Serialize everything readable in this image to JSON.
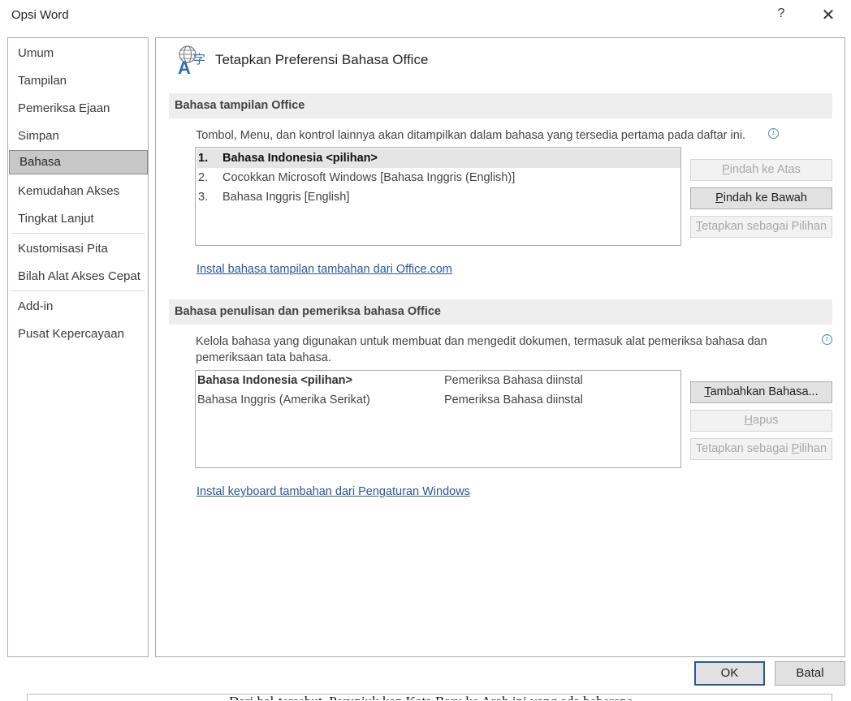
{
  "window": {
    "title": "Opsi Word",
    "help": "?",
    "close": "✕"
  },
  "sidebar": {
    "items": [
      {
        "label": "Umum"
      },
      {
        "label": "Tampilan"
      },
      {
        "label": "Pemeriksa Ejaan"
      },
      {
        "label": "Simpan"
      },
      {
        "label": "Bahasa",
        "selected": true
      },
      {
        "label": "Kemudahan Akses"
      },
      {
        "label": "Tingkat Lanjut"
      },
      {
        "label": "Kustomisasi Pita"
      },
      {
        "label": "Bilah Alat Akses Cepat"
      },
      {
        "label": "Add-in"
      },
      {
        "label": "Pusat Kepercayaan"
      }
    ]
  },
  "header": {
    "title": "Tetapkan Preferensi Bahasa Office",
    "icon": "language-icon"
  },
  "display_section": {
    "title": "Bahasa tampilan Office",
    "description": "Tombol, Menu, dan kontrol lainnya akan ditampilkan dalam bahasa yang tersedia pertama pada daftar ini.",
    "items": [
      {
        "num": "1.",
        "label": "Bahasa Indonesia <pilihan>"
      },
      {
        "num": "2.",
        "label": "Cocokkan Microsoft Windows [Bahasa Inggris (English)]"
      },
      {
        "num": "3.",
        "label": "Bahasa Inggris [English]"
      }
    ],
    "buttons": {
      "move_up": {
        "pre": "",
        "key": "P",
        "post": "indah ke Atas"
      },
      "move_down": {
        "pre": "",
        "key": "P",
        "post": "indah ke Bawah"
      },
      "set_preferred": {
        "pre": "",
        "key": "T",
        "post": "etapkan sebagai Pilihan"
      }
    },
    "link": "Instal bahasa tampilan tambahan dari Office.com"
  },
  "authoring_section": {
    "title": "Bahasa penulisan dan pemeriksa bahasa Office",
    "description_line1": "Kelola bahasa yang digunakan untuk membuat dan mengedit dokumen, termasuk alat pemeriksa bahasa dan",
    "description_line2": "pemeriksaan tata bahasa.",
    "rows": [
      {
        "language": "Bahasa Indonesia <pilihan>",
        "status": "Pemeriksa Bahasa diinstal"
      },
      {
        "language": "Bahasa Inggris (Amerika Serikat)",
        "status": "Pemeriksa Bahasa diinstal"
      }
    ],
    "buttons": {
      "add": {
        "pre": "",
        "key": "T",
        "post": "ambahkan Bahasa..."
      },
      "remove": {
        "pre": "",
        "key": "H",
        "post": "apus"
      },
      "set_preferred": {
        "pre": "Tetapkan sebagai ",
        "key": "P",
        "post": "ilihan"
      }
    },
    "link": "Instal keyboard tambahan dari Pengaturan Windows"
  },
  "footer": {
    "ok": "OK",
    "cancel": "Batal"
  },
  "bottom_text": "Dari hal-tersebut, Perunjuk kan Kata Baru ke Arah ini yang ada beberapa"
}
